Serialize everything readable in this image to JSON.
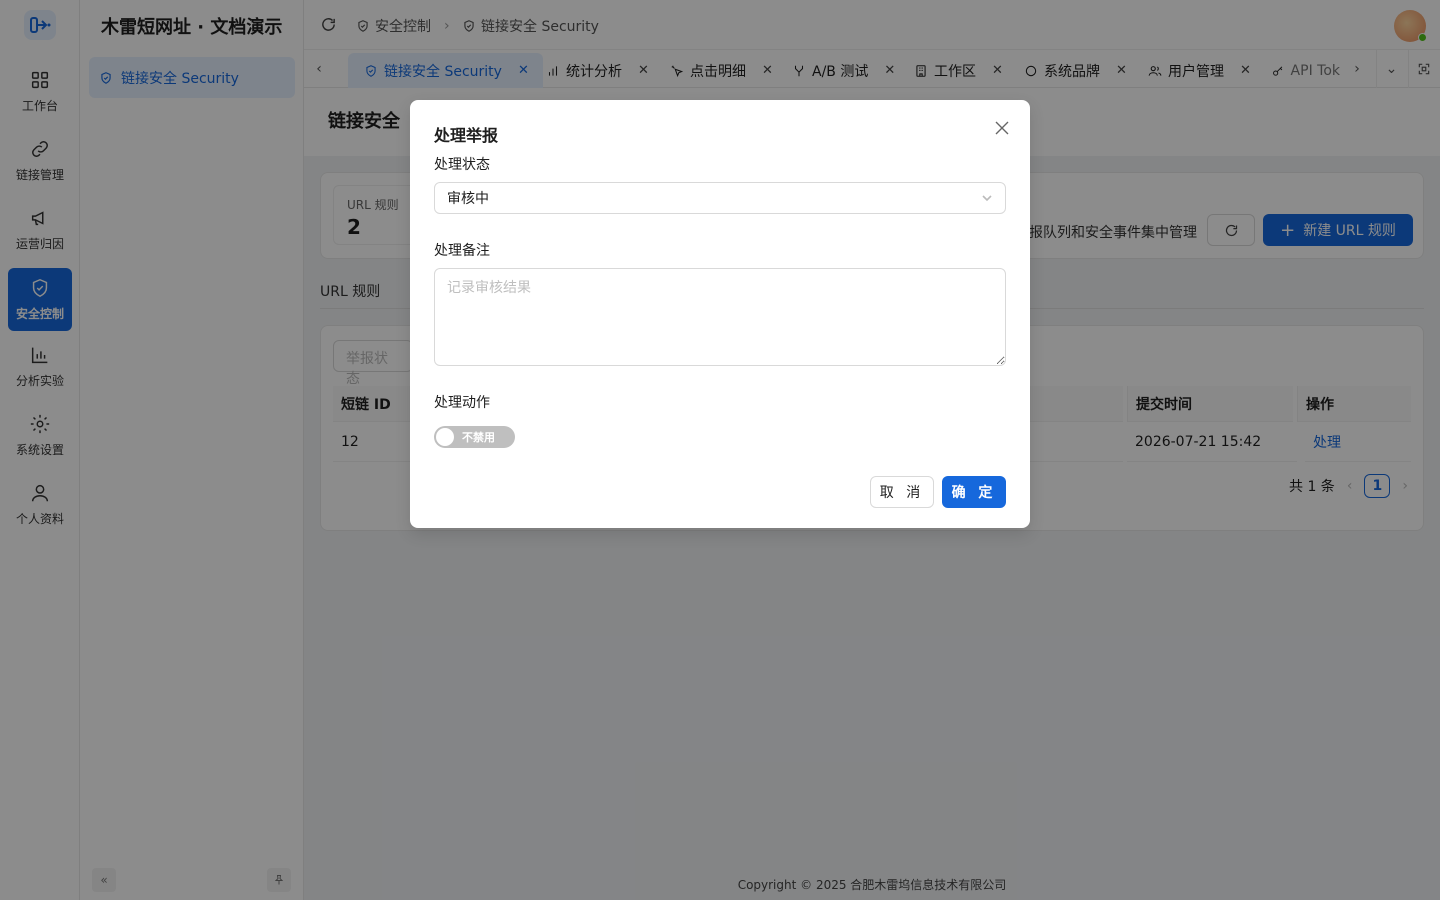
{
  "app": {
    "title": "木雷短网址 · 文档演示"
  },
  "rail": {
    "items": [
      {
        "label": "工作台",
        "icon": "grid-icon"
      },
      {
        "label": "链接管理",
        "icon": "link-icon"
      },
      {
        "label": "运营归因",
        "icon": "megaphone-icon"
      },
      {
        "label": "安全控制",
        "icon": "shield-icon",
        "active": true
      },
      {
        "label": "分析实验",
        "icon": "bar-chart-icon"
      },
      {
        "label": "系统设置",
        "icon": "gear-icon"
      },
      {
        "label": "个人资料",
        "icon": "user-icon"
      }
    ]
  },
  "subnav": {
    "items": [
      {
        "label": "链接安全 Security",
        "icon": "shield-icon"
      }
    ]
  },
  "breadcrumb": {
    "items": [
      "安全控制",
      "链接安全 Security"
    ]
  },
  "tabs": [
    {
      "label": "链接安全 Security",
      "icon": "shield-icon",
      "active": true
    },
    {
      "label": "统计分析",
      "icon": "bar-chart-icon"
    },
    {
      "label": "点击明细",
      "icon": "click-icon"
    },
    {
      "label": "A/B 测试",
      "icon": "split-icon"
    },
    {
      "label": "工作区",
      "icon": "building-icon"
    },
    {
      "label": "系统品牌",
      "icon": "circle-icon"
    },
    {
      "label": "用户管理",
      "icon": "users-icon"
    },
    {
      "label": "API Tok",
      "icon": "key-icon"
    }
  ],
  "page": {
    "title": "链接安全",
    "stat": {
      "label": "URL 规则",
      "value": "2"
    },
    "description": "报队列和安全事件集中管理",
    "new_rule_button": "新建 URL 规则",
    "section_label": "URL 规则",
    "filter_placeholder": "举报状态",
    "table": {
      "headers": [
        "短链 ID",
        "提交时间",
        "操作"
      ],
      "row": {
        "id": "12",
        "time": "2026-07-21 15:42",
        "action": "处理"
      }
    },
    "pager": {
      "total": "共 1 条",
      "current": "1"
    }
  },
  "footer": "Copyright © 2025 合肥木雷坞信息技术有限公司",
  "modal": {
    "title": "处理举报",
    "status_label": "处理状态",
    "status_value": "审核中",
    "note_label": "处理备注",
    "note_placeholder": "记录审核结果",
    "action_label": "处理动作",
    "switch_text": "不禁用",
    "cancel": "取 消",
    "ok": "确 定"
  },
  "colors": {
    "primary": "#1668dc",
    "overlay": "rgba(0,0,0,0.45)"
  }
}
